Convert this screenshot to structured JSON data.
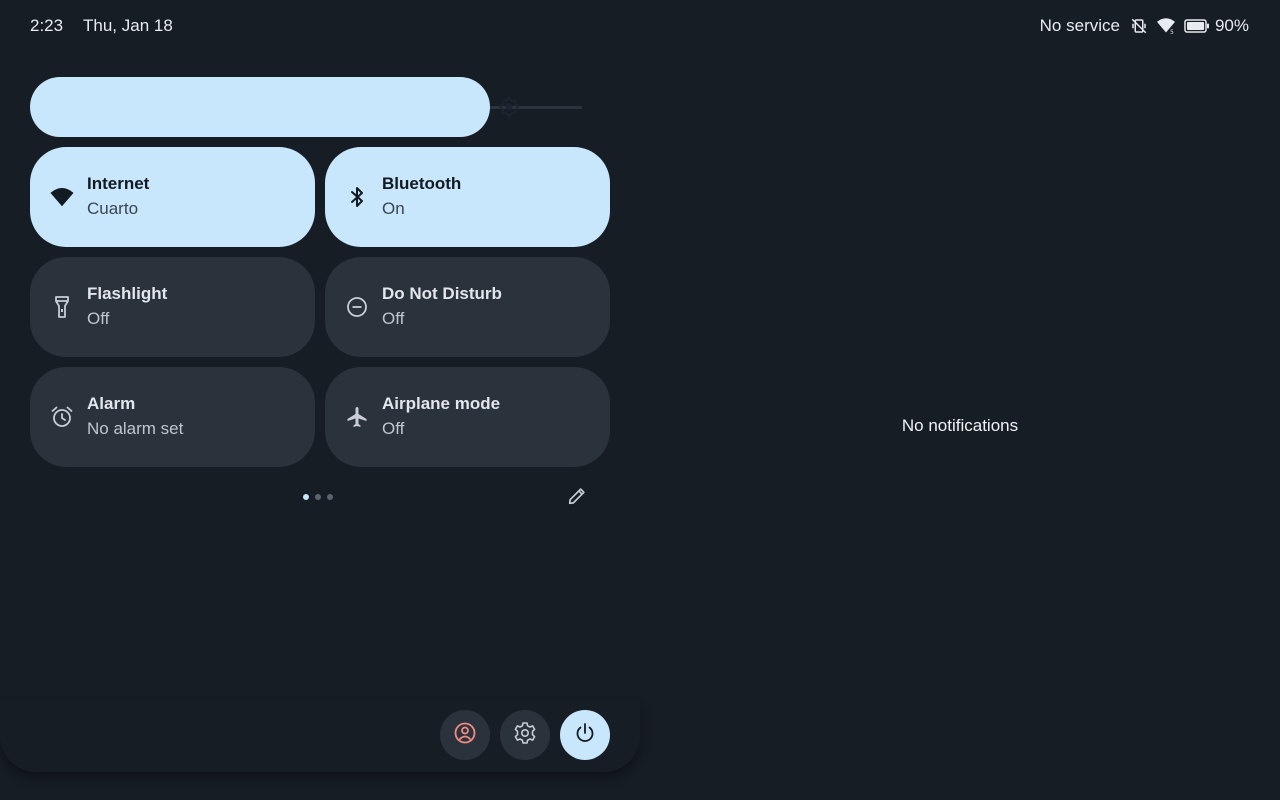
{
  "status_bar": {
    "time": "2:23",
    "date": "Thu, Jan 18",
    "service": "No service",
    "battery_percent": "90%",
    "battery_level": 0.9,
    "icons": [
      "vibrate-off-icon",
      "wifi-icon",
      "battery-icon"
    ]
  },
  "brightness": {
    "level": 0.88,
    "icon": "brightness-icon"
  },
  "tiles": [
    {
      "title": "Internet",
      "subtitle": "Cuarto",
      "icon": "wifi-icon",
      "active": true
    },
    {
      "title": "Bluetooth",
      "subtitle": "On",
      "icon": "bluetooth-icon",
      "active": true
    },
    {
      "title": "Flashlight",
      "subtitle": "Off",
      "icon": "flashlight-icon",
      "active": false
    },
    {
      "title": "Do Not Disturb",
      "subtitle": "Off",
      "icon": "do-not-disturb-icon",
      "active": false
    },
    {
      "title": "Alarm",
      "subtitle": "No alarm set",
      "icon": "alarm-icon",
      "active": false
    },
    {
      "title": "Airplane mode",
      "subtitle": "Off",
      "icon": "airplane-icon",
      "active": false
    }
  ],
  "pagination": {
    "pages": 3,
    "current": 1
  },
  "footer": {
    "buttons": [
      "user-icon",
      "gear-icon",
      "power-icon"
    ]
  },
  "notifications": {
    "empty_text": "No notifications"
  },
  "colors": {
    "background": "#171d25",
    "tile_active": "#c8e6fc",
    "tile_inactive": "#2a323c",
    "user_icon": "#f28b82"
  }
}
